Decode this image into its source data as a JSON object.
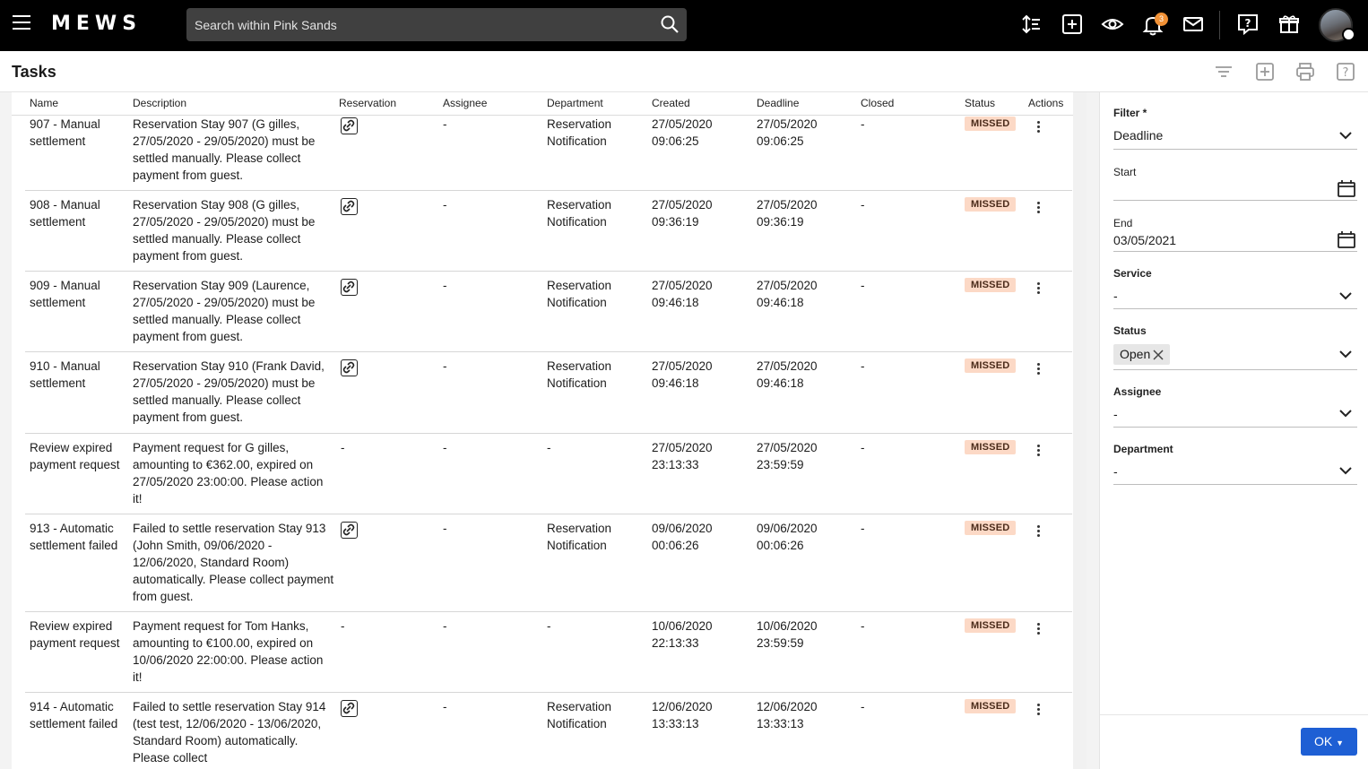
{
  "app": {
    "logo": "MEWS"
  },
  "search": {
    "placeholder": "Search within Pink Sands"
  },
  "notifications": {
    "count": "3"
  },
  "page": {
    "title": "Tasks"
  },
  "columns": [
    "Name",
    "Description",
    "Reservation",
    "Assignee",
    "Department",
    "Created",
    "Deadline",
    "Closed",
    "Status",
    "Actions"
  ],
  "rows": [
    {
      "name": "907 - Manual settlement",
      "description": "Reservation Stay 907 (G gilles, 27/05/2020 - 29/05/2020) must be settled manually. Please collect payment from guest.",
      "reservation": "",
      "assignee": "-",
      "department": "Reservation Notification",
      "created": "27/05/2020 09:06:25",
      "deadline": "27/05/2020 09:06:25",
      "closed": "-",
      "status": "MISSED"
    },
    {
      "name": "908 - Manual settlement",
      "description": "Reservation Stay 908 (G gilles, 27/05/2020 - 29/05/2020) must be settled manually. Please collect payment from guest.",
      "reservation": "",
      "assignee": "-",
      "department": "Reservation Notification",
      "created": "27/05/2020 09:36:19",
      "deadline": "27/05/2020 09:36:19",
      "closed": "-",
      "status": "MISSED"
    },
    {
      "name": "909 - Manual settlement",
      "description": "Reservation Stay 909 (Laurence, 27/05/2020 - 29/05/2020) must be settled manually. Please collect payment from guest.",
      "reservation": "",
      "assignee": "-",
      "department": "Reservation Notification",
      "created": "27/05/2020 09:46:18",
      "deadline": "27/05/2020 09:46:18",
      "closed": "-",
      "status": "MISSED"
    },
    {
      "name": "910 - Manual settlement",
      "description": "Reservation Stay 910 (Frank David, 27/05/2020 - 29/05/2020) must be settled manually. Please collect payment from guest.",
      "reservation": "",
      "assignee": "-",
      "department": "Reservation Notification",
      "created": "27/05/2020 09:46:18",
      "deadline": "27/05/2020 09:46:18",
      "closed": "-",
      "status": "MISSED"
    },
    {
      "name": "Review expired payment request",
      "description": "Payment request for G gilles, amounting to €362.00, expired on 27/05/2020 23:00:00. Please action it!",
      "reservation": "-",
      "assignee": "-",
      "department": "-",
      "created": "27/05/2020 23:13:33",
      "deadline": "27/05/2020 23:59:59",
      "closed": "-",
      "status": "MISSED"
    },
    {
      "name": "913 - Automatic settlement failed",
      "description": "Failed to settle reservation Stay 913 (John Smith, 09/06/2020 - 12/06/2020, Standard Room) automatically. Please collect payment from guest.",
      "reservation": "",
      "assignee": "-",
      "department": "Reservation Notification",
      "created": "09/06/2020 00:06:26",
      "deadline": "09/06/2020 00:06:26",
      "closed": "-",
      "status": "MISSED"
    },
    {
      "name": "Review expired payment request",
      "description": "Payment request for Tom Hanks, amounting to €100.00, expired on 10/06/2020 22:00:00. Please action it!",
      "reservation": "-",
      "assignee": "-",
      "department": "-",
      "created": "10/06/2020 22:13:33",
      "deadline": "10/06/2020 23:59:59",
      "closed": "-",
      "status": "MISSED"
    },
    {
      "name": "914 - Automatic settlement failed",
      "description": "Failed to settle reservation Stay 914 (test test, 12/06/2020 - 13/06/2020, Standard Room) automatically. Please collect",
      "reservation": "",
      "assignee": "-",
      "department": "Reservation Notification",
      "created": "12/06/2020 13:33:13",
      "deadline": "12/06/2020 13:33:13",
      "closed": "-",
      "status": "MISSED"
    }
  ],
  "filters": {
    "filter_label": "Filter *",
    "filter_value": "Deadline",
    "start_label": "Start",
    "start_value": "",
    "end_label": "End",
    "end_value": "03/05/2021",
    "service_label": "Service",
    "service_value": "-",
    "status_label": "Status",
    "status_chip": "Open",
    "assignee_label": "Assignee",
    "assignee_value": "-",
    "department_label": "Department",
    "department_value": "-",
    "ok_label": "OK"
  },
  "colors": {
    "accent": "#1e5fd4",
    "missed_badge": "#fcd9c6",
    "notification_badge": "#f09136",
    "topbar": "#000000"
  }
}
